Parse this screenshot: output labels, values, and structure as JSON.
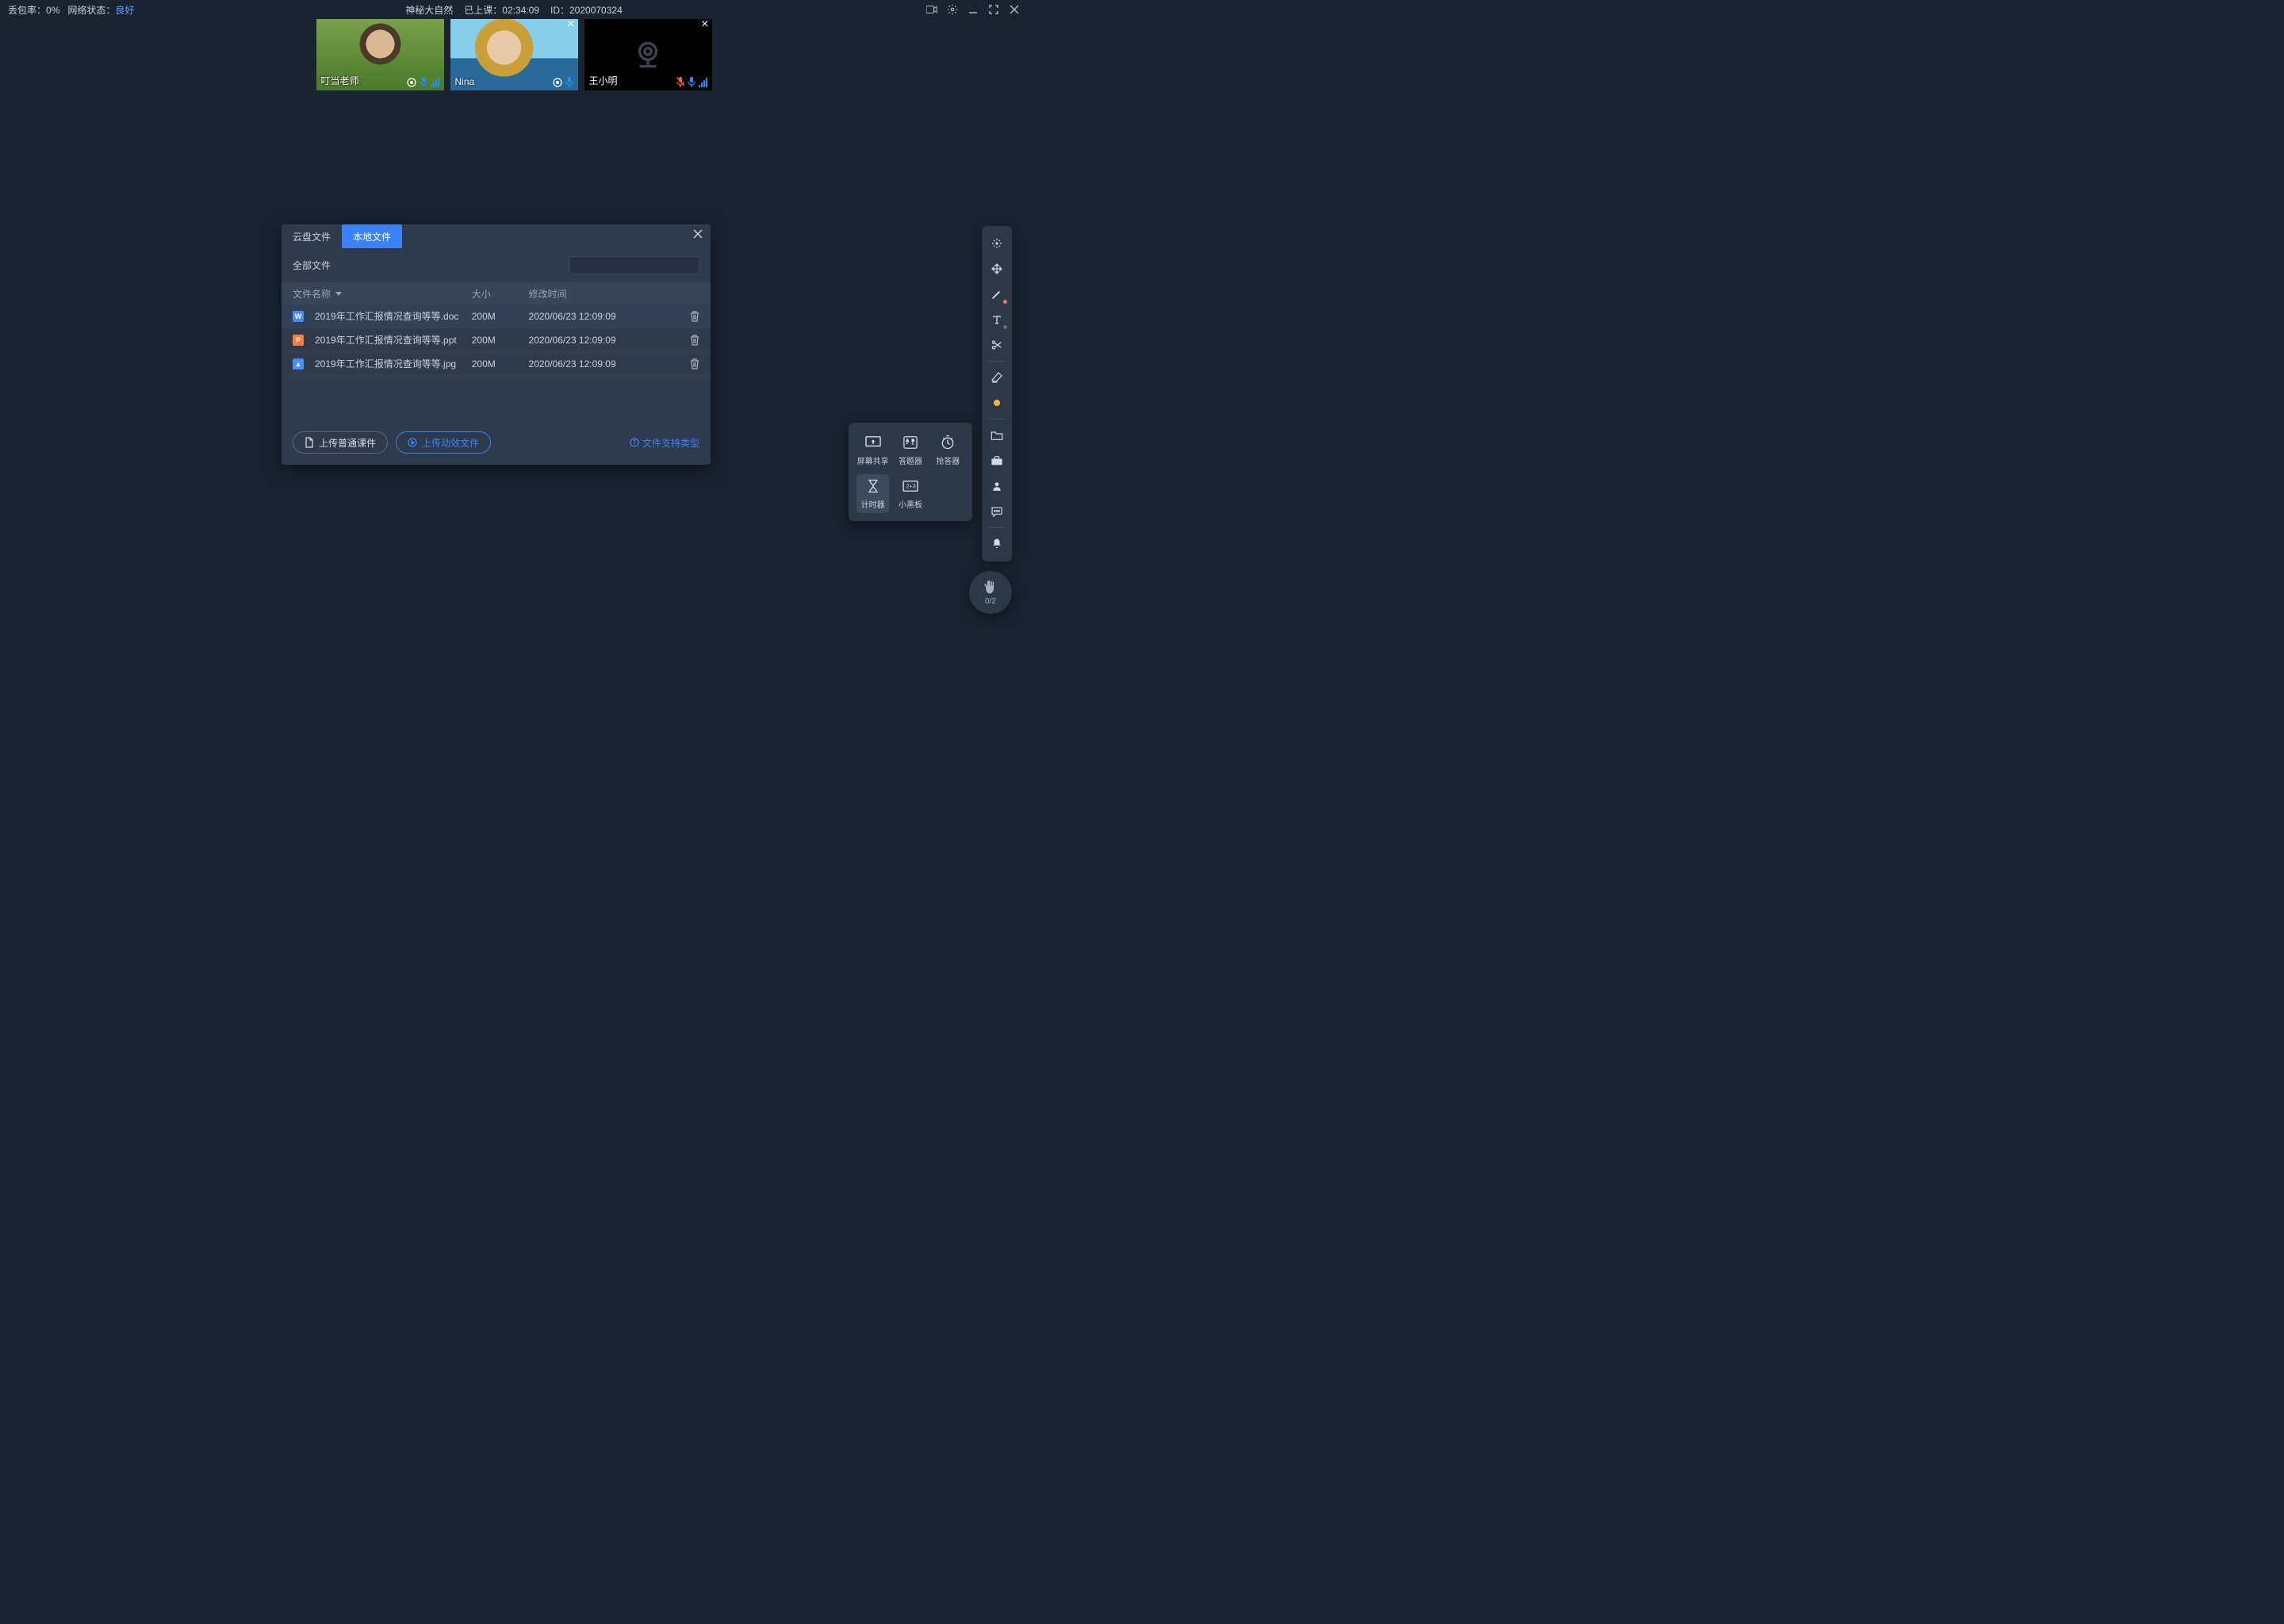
{
  "topbar": {
    "loss_label": "丢包率：",
    "loss_val": "0%",
    "net_label": "网络状态：",
    "net_val": "良好",
    "title": "神秘大自然",
    "time_label": "已上课：",
    "time_val": "02:34:09",
    "id_label": "ID：",
    "id_val": "2020070324"
  },
  "videos": [
    {
      "name": "叮当老师",
      "camera_off": false,
      "closable": false,
      "mic_muted": false
    },
    {
      "name": "Nina",
      "camera_off": false,
      "closable": true,
      "mic_muted": false
    },
    {
      "name": "王小明",
      "camera_off": true,
      "closable": true,
      "mic_muted": true
    }
  ],
  "modal": {
    "tabs": {
      "cloud": "云盘文件",
      "local": "本地文件",
      "active": "local"
    },
    "crumb": "全部文件",
    "headers": {
      "name": "文件名称",
      "size": "大小",
      "mtime": "修改时间"
    },
    "files": [
      {
        "kind": "doc",
        "badge": "W",
        "name": "2019年工作汇报情况查询等等.doc",
        "size": "200M",
        "mtime": "2020/06/23 12:09:09"
      },
      {
        "kind": "ppt",
        "badge": "P",
        "name": "2019年工作汇报情况查询等等.ppt",
        "size": "200M",
        "mtime": "2020/06/23 12:09:09"
      },
      {
        "kind": "jpg",
        "badge": "▲",
        "name": "2019年工作汇报情况查询等等.jpg",
        "size": "200M",
        "mtime": "2020/06/23 12:09:09"
      }
    ],
    "btn_upload": "上传普通课件",
    "btn_upload_anim": "上传动效文件",
    "support_link": "文件支持类型"
  },
  "tools": {
    "screen": "屏幕共享",
    "answer": "答题器",
    "rush": "抢答器",
    "timer": "计时器",
    "board": "小黑板"
  },
  "fab": {
    "count": "0/2"
  }
}
